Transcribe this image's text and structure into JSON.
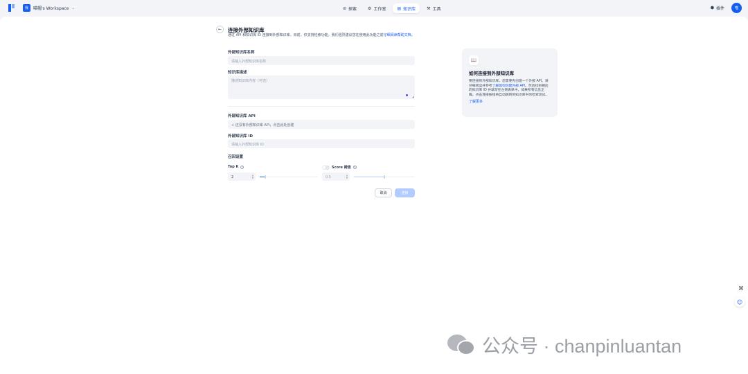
{
  "workspace": {
    "avatar": "我",
    "name": "喵帽's Workspace"
  },
  "nav": [
    {
      "label": "探索",
      "icon": "explore-icon",
      "glyph": "⊘",
      "active": false
    },
    {
      "label": "工作室",
      "icon": "studio-icon",
      "glyph": "⚙",
      "active": false
    },
    {
      "label": "知识库",
      "icon": "knowledge-icon",
      "glyph": "▤",
      "active": true
    },
    {
      "label": "工具",
      "icon": "tools-icon",
      "glyph": "⚒",
      "active": false
    }
  ],
  "header_right": {
    "plugins_label": "插件",
    "user_avatar": "喵"
  },
  "page": {
    "title": "连接外部知识库",
    "desc_prefix": "通过 API 和知识库 ID 连接到外部知识库。目前，仅支持检索功能。我们强烈建议您在使用此功能之前",
    "desc_link": "仔细阅读帮助文档。"
  },
  "form": {
    "name_label": "外部知识库名称",
    "name_placeholder": "请输入外部知识库名称",
    "desc_label": "知识库描述",
    "desc_placeholder": "描述知识库内容（可选）",
    "api_label": "外部知识库 API",
    "api_add_text": "+ 还没有外部知识库 API，点击此处创建",
    "id_label": "外部知识库 ID",
    "id_placeholder": "请输入外部知识库 ID",
    "retrieval_label": "召回设置",
    "top_k_label": "Top K",
    "top_k_value": "2",
    "top_k_slider_fraction": 0.1,
    "score_label": "Score 阈值",
    "score_value": "0.5",
    "score_enabled": false,
    "score_slider_fraction": 0.5,
    "cancel_label": "取消",
    "connect_label": "连接"
  },
  "help_card": {
    "title": "如何连接到外部知识库",
    "text_1": "要连接到外部知识库，您需要先创建一个外部 API。请仔细阅读并参考",
    "text_link": "了解如何创建外部 API",
    "text_2": "。然后找到相应的知识库 ID 并填写在左侧表单中。如果所有信息正确，点击连接按钮将自动跳转到知识库中的检索测试。",
    "more_label": "了解更多"
  },
  "watermark": {
    "text": "公众号 · chanpinluantan"
  },
  "colors": {
    "accent": "#155eef",
    "muted_button": "#b2ccff",
    "background": "#f2f4f7"
  }
}
